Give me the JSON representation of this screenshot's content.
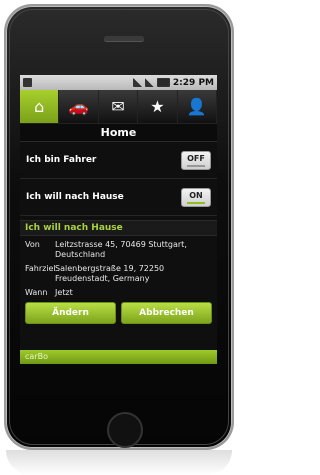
{
  "status_bar": {
    "time": "2:29 PM"
  },
  "tabs": [
    {
      "id": "home",
      "icon": "home-icon",
      "glyph": "⌂"
    },
    {
      "id": "car",
      "icon": "car-icon",
      "glyph": "🚗"
    },
    {
      "id": "messages",
      "icon": "mail-icon",
      "glyph": "✉"
    },
    {
      "id": "favorites",
      "icon": "star-icon",
      "glyph": "★"
    },
    {
      "id": "profile",
      "icon": "person-icon",
      "glyph": "👤"
    }
  ],
  "page": {
    "title": "Home"
  },
  "toggles": [
    {
      "label": "Ich bin Fahrer",
      "state": "OFF"
    },
    {
      "label": "Ich will nach Hause",
      "state": "ON"
    }
  ],
  "section": {
    "title": "Ich will nach Hause"
  },
  "details": [
    {
      "label": "Von",
      "value": "Leitzstrasse 45, 70469 Stuttgart, Deutschland"
    },
    {
      "label": "Fahrziel",
      "value": "Salenbergstraße 19, 72250 Freudenstadt, Germany"
    },
    {
      "label": "Wann",
      "value": "Jetzt"
    }
  ],
  "buttons": {
    "change": "Ändern",
    "cancel": "Abbrechen"
  },
  "footer": {
    "brand": "carBo"
  },
  "colors": {
    "accent": "#8fc21f",
    "header_text": "#a9d33b"
  }
}
